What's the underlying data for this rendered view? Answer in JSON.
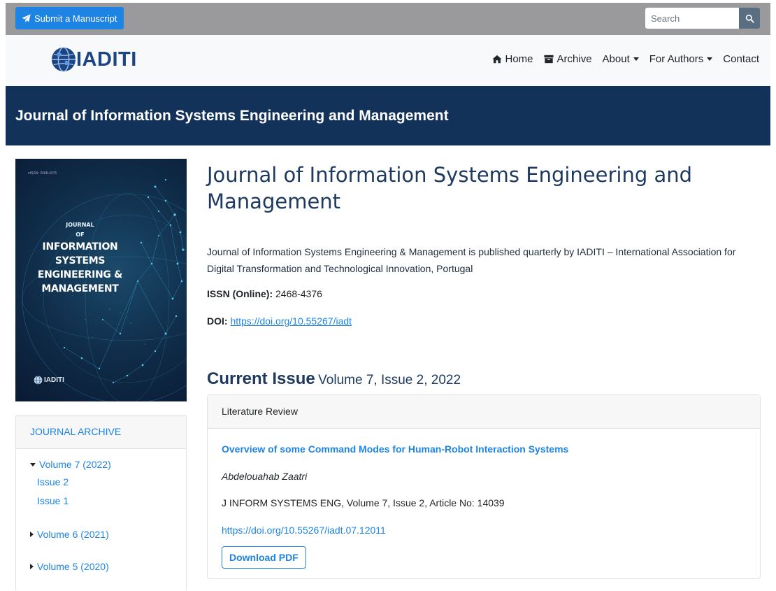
{
  "topbar": {
    "submit_label": "Submit a Manuscript",
    "search_placeholder": "Search"
  },
  "navbar": {
    "logo_text": "IADITI",
    "links": [
      {
        "label": "Home",
        "icon": "home-icon"
      },
      {
        "label": "Archive",
        "icon": "archive-icon"
      },
      {
        "label": "About",
        "dropdown": true
      },
      {
        "label": "For Authors",
        "dropdown": true
      },
      {
        "label": "Contact"
      }
    ]
  },
  "band": {
    "title": "Journal of Information Systems Engineering and Management"
  },
  "cover": {
    "issn": "eISSN: 2468-4376",
    "line1": "JOURNAL",
    "line2": "OF",
    "line3": "INFORMATION",
    "line4": "SYSTEMS",
    "line5": "ENGINEERING &",
    "line6": "MANAGEMENT",
    "logo": "IADITI"
  },
  "archive": {
    "heading": "JOURNAL ARCHIVE",
    "volumes": [
      {
        "label": "Volume 7 (2022)",
        "expanded": true,
        "issues": [
          "Issue 2",
          "Issue 1"
        ]
      },
      {
        "label": "Volume 6 (2021)",
        "expanded": false
      },
      {
        "label": "Volume 5 (2020)",
        "expanded": false
      }
    ]
  },
  "main": {
    "title": "Journal of Information Systems Engineering and Management",
    "description": "Journal of Information Systems Engineering & Management is published quarterly by IADITI – International Association for Digital Transformation and Technological Innovation, Portugal",
    "issn_label": "ISSN (Online):",
    "issn_value": "2468-4376",
    "doi_label": "DOI:",
    "doi_value": "https://doi.org/10.55267/iadt"
  },
  "current_issue": {
    "label": "Current Issue",
    "volume": "Volume 7, Issue 2, 2022",
    "section": "Literature Review",
    "article": {
      "title": "Overview of some Command Modes for Human-Robot Interaction Systems",
      "author": "Abdelouahab Zaatri",
      "citation": "J INFORM SYSTEMS ENG, Volume 7, Issue 2, Article No: 14039",
      "doi": "https://doi.org/10.55267/iadt.07.12011",
      "download_label": "Download PDF"
    }
  },
  "colors": {
    "accent": "#1d84e4",
    "band": "#13325a",
    "topbar": "#9a9a9d"
  }
}
